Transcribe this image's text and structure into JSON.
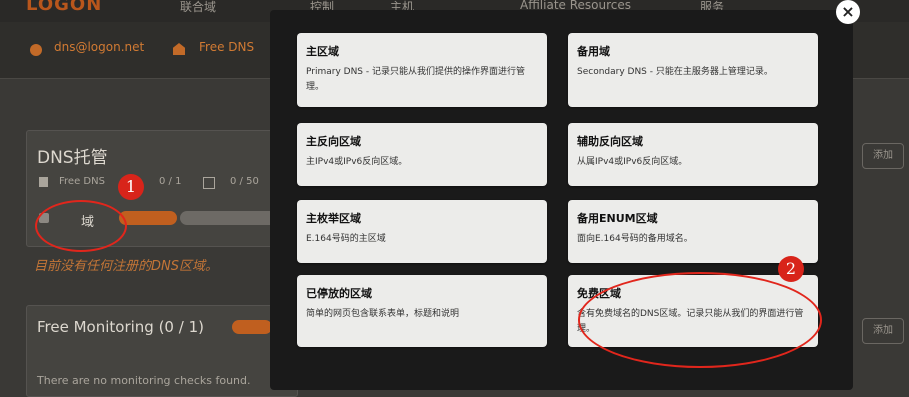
{
  "header": {
    "logo": "LOGON",
    "nav": [
      "联合域",
      "控制",
      "主机",
      "Affiliate Resources",
      "服务"
    ]
  },
  "subbar": {
    "email": "dns@logon.net",
    "free_dns": "Free DNS"
  },
  "dns_card": {
    "title": "DNS托管",
    "free_dns_label": "Free DNS",
    "count_a": "0 / 1",
    "count_b": "0 / 50",
    "domain_label": "域",
    "empty_message": "目前没有任何注册的DNS区域。"
  },
  "monitoring_card": {
    "title": "Free Monitoring (0 / 1)",
    "note": "There are no monitoring checks found."
  },
  "side_buttons": [
    "添加",
    "添加"
  ],
  "modal": {
    "close_label": "×",
    "options": [
      {
        "title": "主区域",
        "desc": "Primary DNS - 记录只能从我们提供的操作界面进行管理。"
      },
      {
        "title": "备用域",
        "desc": "Secondary DNS - 只能在主服务器上管理记录。"
      },
      {
        "title": "主反向区域",
        "desc": "主IPv4或IPv6反向区域。"
      },
      {
        "title": "辅助反向区域",
        "desc": "从属IPv4或IPv6反向区域。"
      },
      {
        "title": "主枚举区域",
        "desc": "E.164号码的主区域"
      },
      {
        "title": "备用ENUM区域",
        "desc": "面向E.164号码的备用域名。"
      },
      {
        "title": "已停放的区域",
        "desc": "简单的网页包含联系表单，标题和说明"
      },
      {
        "title": "免费区域",
        "desc": "含有免费域名的DNS区域。记录只能从我们的界面进行管理。"
      }
    ]
  },
  "annotations": [
    "1",
    "2"
  ]
}
